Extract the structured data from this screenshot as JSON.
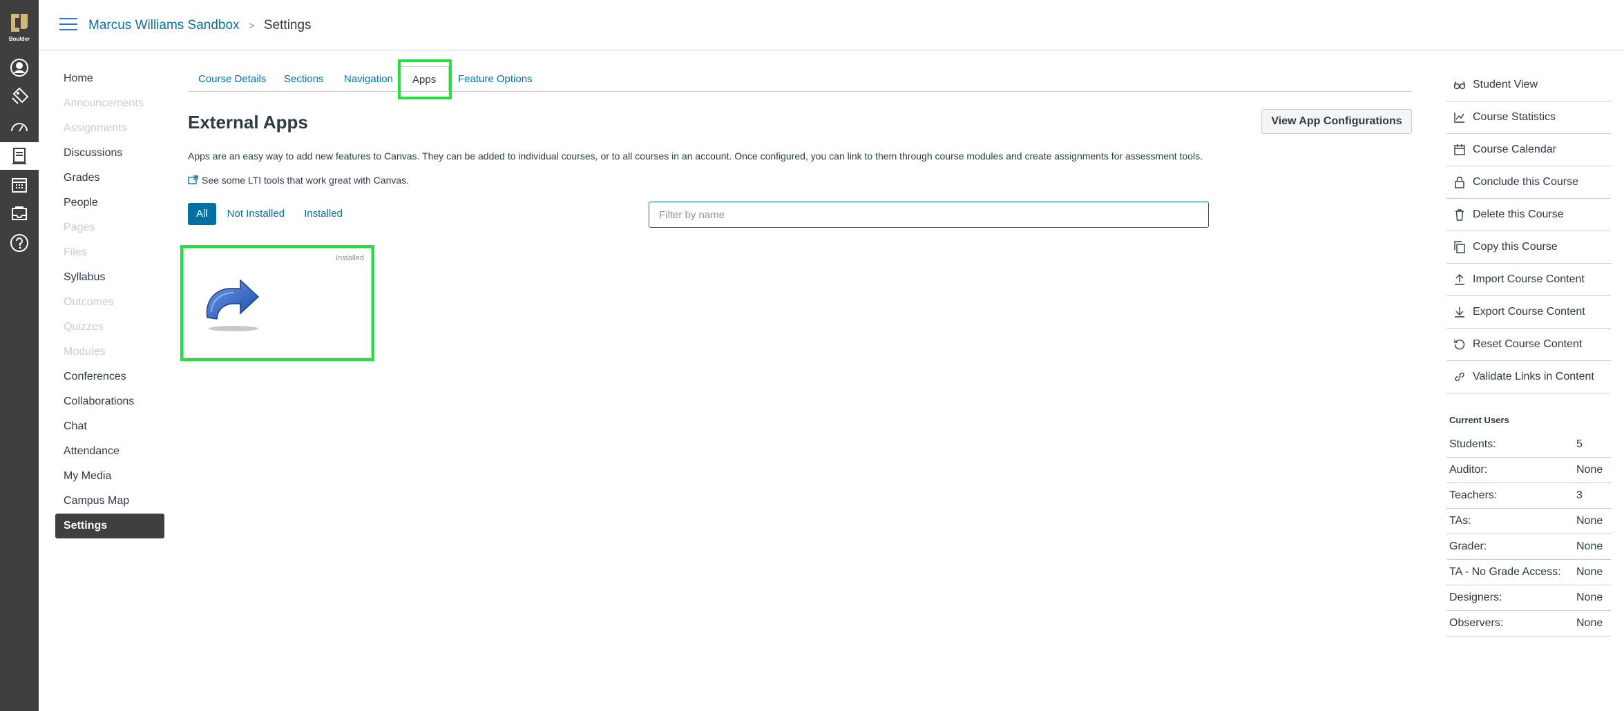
{
  "global_nav": {
    "logo_text": "Boulder",
    "items": [
      {
        "name": "account-icon"
      },
      {
        "name": "admin-icon"
      },
      {
        "name": "dashboard-icon"
      },
      {
        "name": "courses-icon"
      },
      {
        "name": "calendar-icon"
      },
      {
        "name": "inbox-icon"
      },
      {
        "name": "help-icon"
      }
    ]
  },
  "header": {
    "course_name": "Marcus Williams Sandbox",
    "separator": ">",
    "current": "Settings"
  },
  "course_nav": {
    "items": [
      {
        "label": "Home",
        "state": "enabled"
      },
      {
        "label": "Announcements",
        "state": "disabled"
      },
      {
        "label": "Assignments",
        "state": "disabled"
      },
      {
        "label": "Discussions",
        "state": "enabled"
      },
      {
        "label": "Grades",
        "state": "enabled"
      },
      {
        "label": "People",
        "state": "enabled"
      },
      {
        "label": "Pages",
        "state": "disabled"
      },
      {
        "label": "Files",
        "state": "disabled"
      },
      {
        "label": "Syllabus",
        "state": "enabled"
      },
      {
        "label": "Outcomes",
        "state": "disabled"
      },
      {
        "label": "Quizzes",
        "state": "disabled"
      },
      {
        "label": "Modules",
        "state": "disabled"
      },
      {
        "label": "Conferences",
        "state": "enabled"
      },
      {
        "label": "Collaborations",
        "state": "enabled"
      },
      {
        "label": "Chat",
        "state": "enabled"
      },
      {
        "label": "Attendance",
        "state": "enabled"
      },
      {
        "label": "My Media",
        "state": "enabled"
      },
      {
        "label": "Campus Map",
        "state": "enabled"
      },
      {
        "label": "Settings",
        "state": "active"
      }
    ]
  },
  "tabs": [
    {
      "label": "Course Details",
      "active": false
    },
    {
      "label": "Sections",
      "active": false
    },
    {
      "label": "Navigation",
      "active": false
    },
    {
      "label": "Apps",
      "active": true
    },
    {
      "label": "Feature Options",
      "active": false
    }
  ],
  "main": {
    "title": "External Apps",
    "view_config_button": "View App Configurations",
    "description": "Apps are an easy way to add new features to Canvas. They can be added to individual courses, or to all courses in an account. Once configured, you can link to them through course modules and create assignments for assessment tools.",
    "lti_link": "See some LTI tools that work great with Canvas.",
    "filters": [
      {
        "label": "All",
        "active": true
      },
      {
        "label": "Not Installed",
        "active": false
      },
      {
        "label": "Installed",
        "active": false
      }
    ],
    "filter_placeholder": "Filter by name",
    "apps": [
      {
        "status": "Installed",
        "icon": "redirect-arrow-icon"
      }
    ]
  },
  "right_sidebar": {
    "actions": [
      {
        "label": "Student View",
        "icon": "glasses-icon"
      },
      {
        "label": "Course Statistics",
        "icon": "statistics-icon"
      },
      {
        "label": "Course Calendar",
        "icon": "calendar-icon"
      },
      {
        "label": "Conclude this Course",
        "icon": "lock-icon"
      },
      {
        "label": "Delete this Course",
        "icon": "trash-icon"
      },
      {
        "label": "Copy this Course",
        "icon": "copy-icon"
      },
      {
        "label": "Import Course Content",
        "icon": "upload-icon"
      },
      {
        "label": "Export Course Content",
        "icon": "download-icon"
      },
      {
        "label": "Reset Course Content",
        "icon": "reset-icon"
      },
      {
        "label": "Validate Links in Content",
        "icon": "link-icon"
      }
    ],
    "current_users_title": "Current Users",
    "current_users": [
      {
        "role": "Students:",
        "count": "5"
      },
      {
        "role": "Auditor:",
        "count": "None"
      },
      {
        "role": "Teachers:",
        "count": "3"
      },
      {
        "role": "TAs:",
        "count": "None"
      },
      {
        "role": "Grader:",
        "count": "None"
      },
      {
        "role": "TA - No Grade Access:",
        "count": "None"
      },
      {
        "role": "Designers:",
        "count": "None"
      },
      {
        "role": "Observers:",
        "count": "None"
      }
    ]
  },
  "colors": {
    "link": "#0770a3",
    "highlight": "#21e23d",
    "nav_bg": "#3f3f3f"
  }
}
